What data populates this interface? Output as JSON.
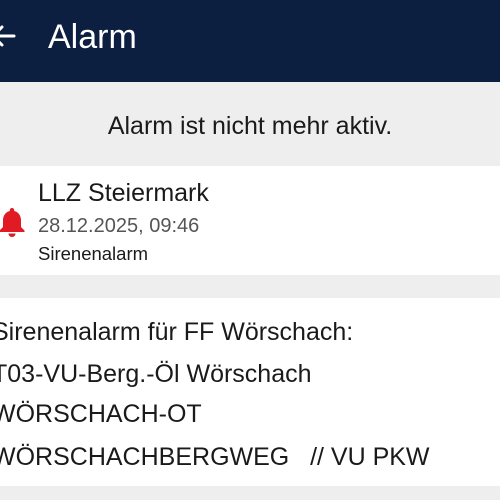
{
  "appbar": {
    "title": "Alarm",
    "back_icon": "arrow-left-icon",
    "background": "#0d1f40"
  },
  "status": {
    "text": "Alarm ist nicht mehr aktiv."
  },
  "alarm_card": {
    "icon": "bell-icon",
    "icon_color": "#e01b24",
    "source": "LLZ Steiermark",
    "datetime": "28.12.2025, 09:46",
    "type": "Sirenenalarm"
  },
  "message": {
    "lines": [
      "Sirenenalarm für FF Wörschach:",
      "T03-VU-Berg.-Öl Wörschach",
      "WÖRSCHACH-OT",
      "WÖRSCHACHBERGWEG   // VU PKW"
    ]
  }
}
